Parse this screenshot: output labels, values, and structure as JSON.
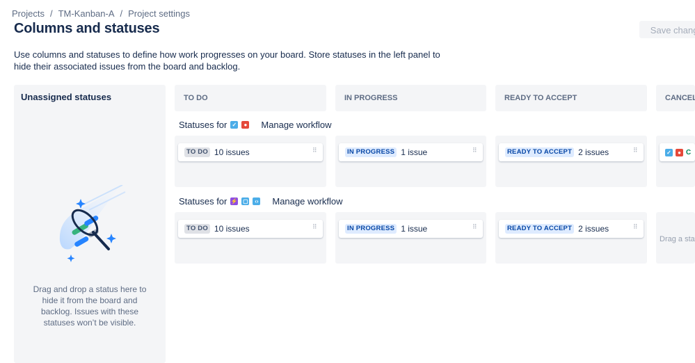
{
  "breadcrumb": {
    "projects": "Projects",
    "project": "TM-Kanban-A",
    "settings": "Project settings",
    "sep": "/"
  },
  "page": {
    "title": "Columns and statuses",
    "save_label": "Save changes",
    "description": "Use columns and statuses to define how work progresses on your board. Store statuses in the left panel to hide their associated issues from the board and backlog."
  },
  "unassigned": {
    "title": "Unassigned statuses",
    "hint": "Drag and drop a status here to hide it from the board and backlog. Issues with these statuses won’t be visible.",
    "illustration": "drag-status-illustration"
  },
  "columns": [
    {
      "title": "TO DO"
    },
    {
      "title": "IN PROGRESS"
    },
    {
      "title": "READY TO ACCEPT"
    },
    {
      "title": "CANCELLED"
    }
  ],
  "groups": [
    {
      "label": "Statuses for",
      "manage": "Manage workflow",
      "types": [
        "task-icon",
        "bug-icon"
      ],
      "cards": [
        {
          "status": "TO DO",
          "count": "10 issues"
        },
        {
          "status": "IN PROGRESS",
          "count": "1 issue"
        },
        {
          "status": "READY TO ACCEPT",
          "count": "2 issues"
        },
        {
          "status": "",
          "count": "C"
        }
      ]
    },
    {
      "label": "Statuses for",
      "manage": "Manage workflow",
      "types": [
        "epic-icon",
        "subtask-icon",
        "code-icon"
      ],
      "cards": [
        {
          "status": "TO DO",
          "count": "10 issues"
        },
        {
          "status": "IN PROGRESS",
          "count": "1 issue"
        },
        {
          "status": "READY TO ACCEPT",
          "count": "2 issues"
        }
      ],
      "drop_hint": "Drag a status"
    }
  ],
  "colors": {
    "task": "#4bade8",
    "bug": "#e5493a",
    "epic": "#904ee2",
    "subtask": "#4bade8",
    "code": "#4bade8",
    "accent_green": "#00875a"
  }
}
